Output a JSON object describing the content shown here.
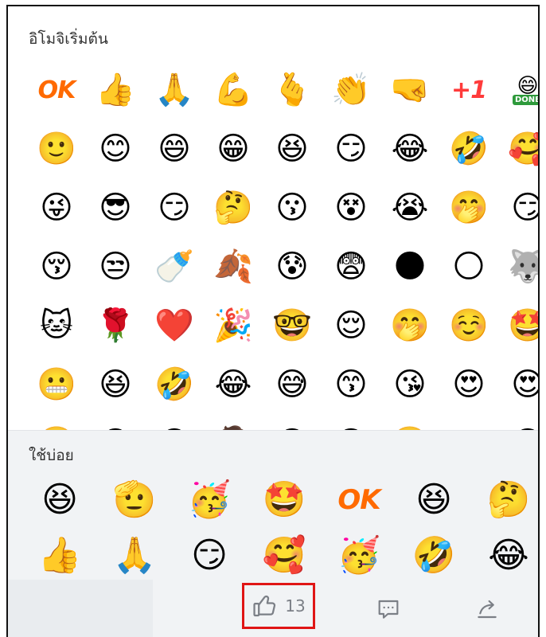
{
  "all_emoji": {
    "title": "อิโมจิเริ่มต้น",
    "items": [
      {
        "name": "ok",
        "glyph": "OK",
        "type": "text"
      },
      {
        "name": "thumbs-up",
        "glyph": "👍"
      },
      {
        "name": "pray",
        "glyph": "🙏"
      },
      {
        "name": "muscle",
        "glyph": "💪"
      },
      {
        "name": "finger-heart",
        "glyph": "🫰"
      },
      {
        "name": "clap",
        "glyph": "👏"
      },
      {
        "name": "fist-bump",
        "glyph": "🤜"
      },
      {
        "name": "plus-one",
        "glyph": "+1",
        "type": "text"
      },
      {
        "name": "done",
        "glyph": "😄",
        "type": "done",
        "tag": "DONE"
      },
      {
        "name": "smile",
        "glyph": "🙂"
      },
      {
        "name": "blush-smile",
        "glyph": "😊"
      },
      {
        "name": "grin",
        "glyph": "😄"
      },
      {
        "name": "big-grin",
        "glyph": "😁"
      },
      {
        "name": "laugh-squint",
        "glyph": "😆"
      },
      {
        "name": "smirk-side",
        "glyph": "😏"
      },
      {
        "name": "joy",
        "glyph": "😂"
      },
      {
        "name": "rofl",
        "glyph": "🤣"
      },
      {
        "name": "heart-hands",
        "glyph": "🥰"
      },
      {
        "name": "tongue-wink",
        "glyph": "😜"
      },
      {
        "name": "sunglasses",
        "glyph": "😎"
      },
      {
        "name": "sparkle-smirk",
        "glyph": "😏"
      },
      {
        "name": "thinking",
        "glyph": "🤔"
      },
      {
        "name": "whistle",
        "glyph": "😗"
      },
      {
        "name": "dizzy-think",
        "glyph": "😵"
      },
      {
        "name": "crying",
        "glyph": "😭"
      },
      {
        "name": "hand-over-mouth",
        "glyph": "🤭"
      },
      {
        "name": "smirk",
        "glyph": "😏"
      },
      {
        "name": "kiss-blush",
        "glyph": "😚"
      },
      {
        "name": "unamused",
        "glyph": "😒"
      },
      {
        "name": "baby-bottle",
        "glyph": "🍼"
      },
      {
        "name": "leaf-face",
        "glyph": "🍂"
      },
      {
        "name": "black-blob-sweat",
        "glyph": "😰"
      },
      {
        "name": "scared-sweat",
        "glyph": "😨"
      },
      {
        "name": "dark-blob",
        "glyph": "🌑"
      },
      {
        "name": "yellow-blob",
        "glyph": "🌕"
      },
      {
        "name": "husky",
        "glyph": "🐺"
      },
      {
        "name": "cat",
        "glyph": "🐱"
      },
      {
        "name": "rose",
        "glyph": "🌹"
      },
      {
        "name": "heart",
        "glyph": "❤️"
      },
      {
        "name": "party-popper",
        "glyph": "🎉"
      },
      {
        "name": "nerd-grin",
        "glyph": "🤓"
      },
      {
        "name": "pleased",
        "glyph": "😌"
      },
      {
        "name": "giggle",
        "glyph": "🤭"
      },
      {
        "name": "happy",
        "glyph": "☺️"
      },
      {
        "name": "star-struck",
        "glyph": "🤩"
      },
      {
        "name": "toothy-smile",
        "glyph": "😬"
      },
      {
        "name": "hearty-laugh",
        "glyph": "😆"
      },
      {
        "name": "rolling-laugh",
        "glyph": "🤣"
      },
      {
        "name": "tears-of-joy",
        "glyph": "😂"
      },
      {
        "name": "sweat-grin",
        "glyph": "😅"
      },
      {
        "name": "kissing",
        "glyph": "😙"
      },
      {
        "name": "blow-kiss",
        "glyph": "😘"
      },
      {
        "name": "heart-eyes-blush",
        "glyph": "😍"
      },
      {
        "name": "heart-eyes",
        "glyph": "😍"
      },
      {
        "name": "dizzy-eyes",
        "glyph": "😵‍💫"
      },
      {
        "name": "squint-wink",
        "glyph": "😉"
      },
      {
        "name": "cool",
        "glyph": "😎"
      },
      {
        "name": "facepalm",
        "glyph": "🤦"
      },
      {
        "name": "sweat-laugh",
        "glyph": "😅"
      },
      {
        "name": "angry",
        "glyph": "😠"
      },
      {
        "name": "headband",
        "glyph": "😤"
      },
      {
        "name": "peek",
        "glyph": "👀"
      },
      {
        "name": "surprised",
        "glyph": "😮"
      }
    ]
  },
  "recent_emoji": {
    "title": "ใช้บ่อย",
    "items": [
      {
        "name": "hands-cheeks",
        "glyph": "😆"
      },
      {
        "name": "salute",
        "glyph": "🫡"
      },
      {
        "name": "celebrate",
        "glyph": "🥳"
      },
      {
        "name": "star-eyes",
        "glyph": "🤩"
      },
      {
        "name": "ok",
        "glyph": "OK",
        "type": "text"
      },
      {
        "name": "laugh",
        "glyph": "😆"
      },
      {
        "name": "confused",
        "glyph": "🤔"
      },
      {
        "name": "thumbs-up",
        "glyph": "👍"
      },
      {
        "name": "pray",
        "glyph": "🙏"
      },
      {
        "name": "sparkle-smirk",
        "glyph": "😏"
      },
      {
        "name": "heart-hug",
        "glyph": "🥰"
      },
      {
        "name": "party-face",
        "glyph": "🥳"
      },
      {
        "name": "rofl",
        "glyph": "🤣"
      },
      {
        "name": "joy",
        "glyph": "😂"
      }
    ]
  },
  "toolbar": {
    "like_icon": "thumbs-up-outline-icon",
    "like_count": "13",
    "comment_icon": "comment-icon",
    "share_icon": "share-icon",
    "highlight_color": "#e01515",
    "icon_color": "#7b7f86"
  }
}
